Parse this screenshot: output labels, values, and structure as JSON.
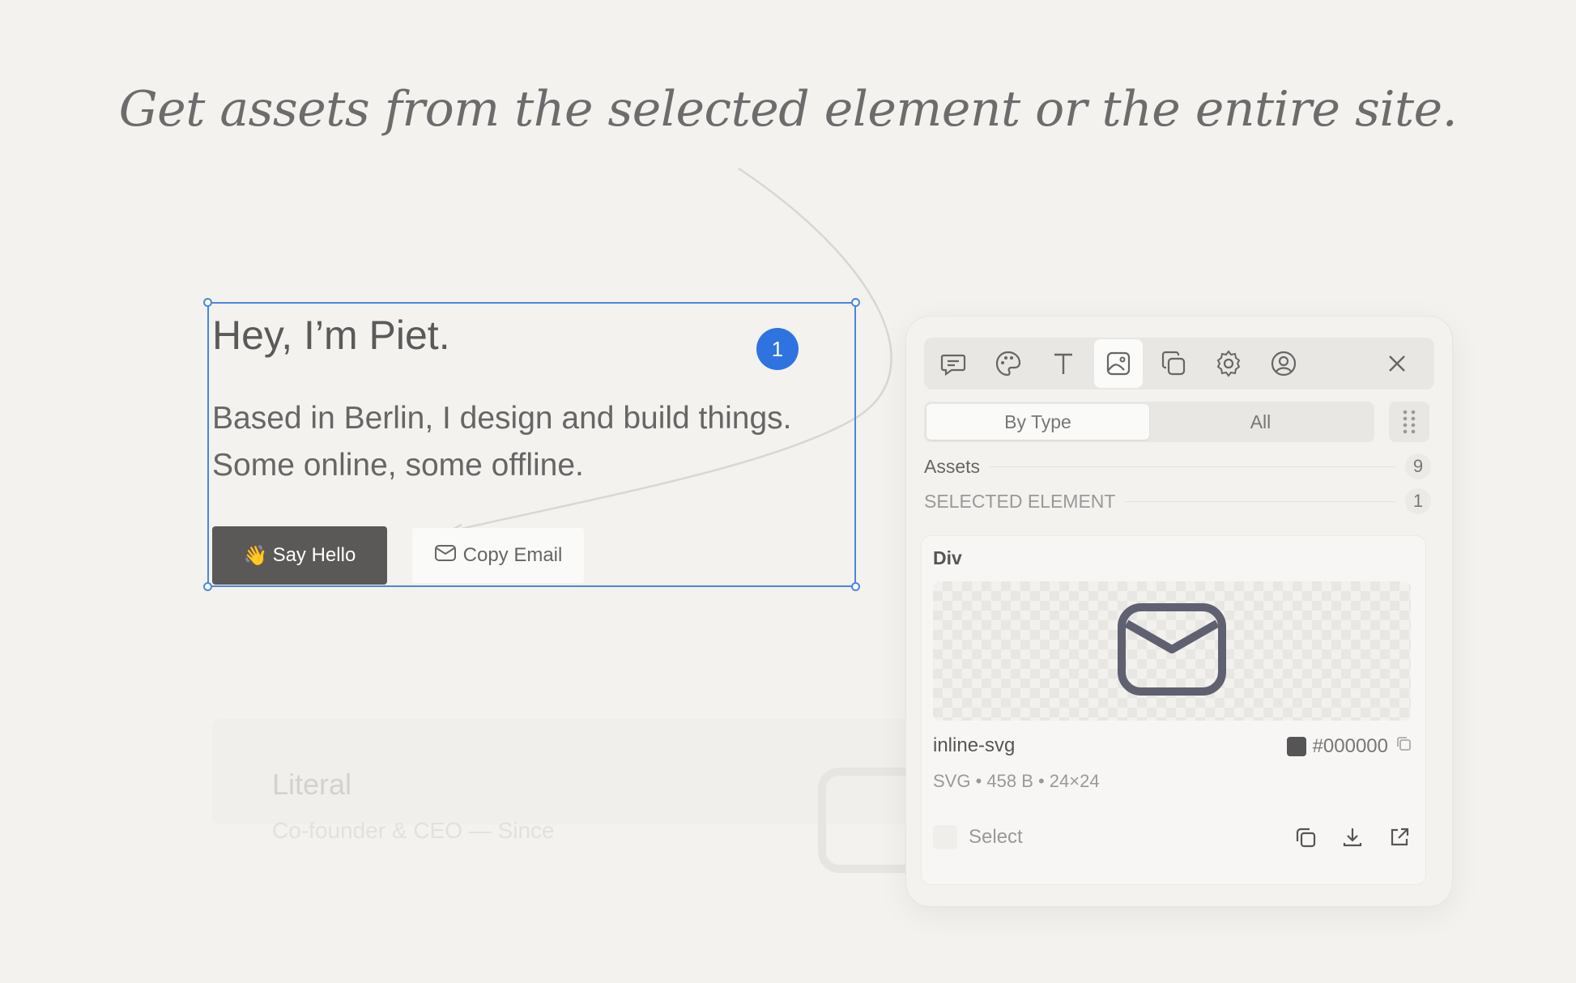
{
  "headline": "Get assets from the selected element or the entire site.",
  "background_card": {
    "title": "Literal",
    "subtitle": "Co-founder & CEO — Since"
  },
  "selected_element": {
    "title": "Hey, I’m Piet.",
    "line1": "Based in Berlin, I design and build things.",
    "line2": "Some online, some offline.",
    "badge": "1",
    "primary_button": {
      "emoji": "👋",
      "label": "Say Hello"
    },
    "secondary_button": {
      "icon": "mail-icon",
      "label": "Copy Email"
    }
  },
  "panel": {
    "toolbar": [
      {
        "name": "comment-icon",
        "active": false
      },
      {
        "name": "palette-icon",
        "active": false
      },
      {
        "name": "typography-icon",
        "active": false
      },
      {
        "name": "image-icon",
        "active": true
      },
      {
        "name": "layers-icon",
        "active": false
      },
      {
        "name": "settings-icon",
        "active": false
      },
      {
        "name": "user-icon",
        "active": false
      }
    ],
    "close_icon": "close-icon",
    "tabs": [
      {
        "label": "By Type",
        "active": true
      },
      {
        "label": "All",
        "active": false
      }
    ],
    "assets": {
      "label": "Assets",
      "count": "9"
    },
    "selected": {
      "label": "SELECTED ELEMENT",
      "count": "1"
    },
    "card": {
      "title": "Div",
      "preview_icon": "mail-icon",
      "name": "inline-svg",
      "color_hex": "#000000",
      "swatch_color": "#555555",
      "meta": "SVG • 458 B • 24×24",
      "select_label": "Select",
      "actions": [
        "copy-icon",
        "download-icon",
        "external-link-icon"
      ]
    }
  }
}
